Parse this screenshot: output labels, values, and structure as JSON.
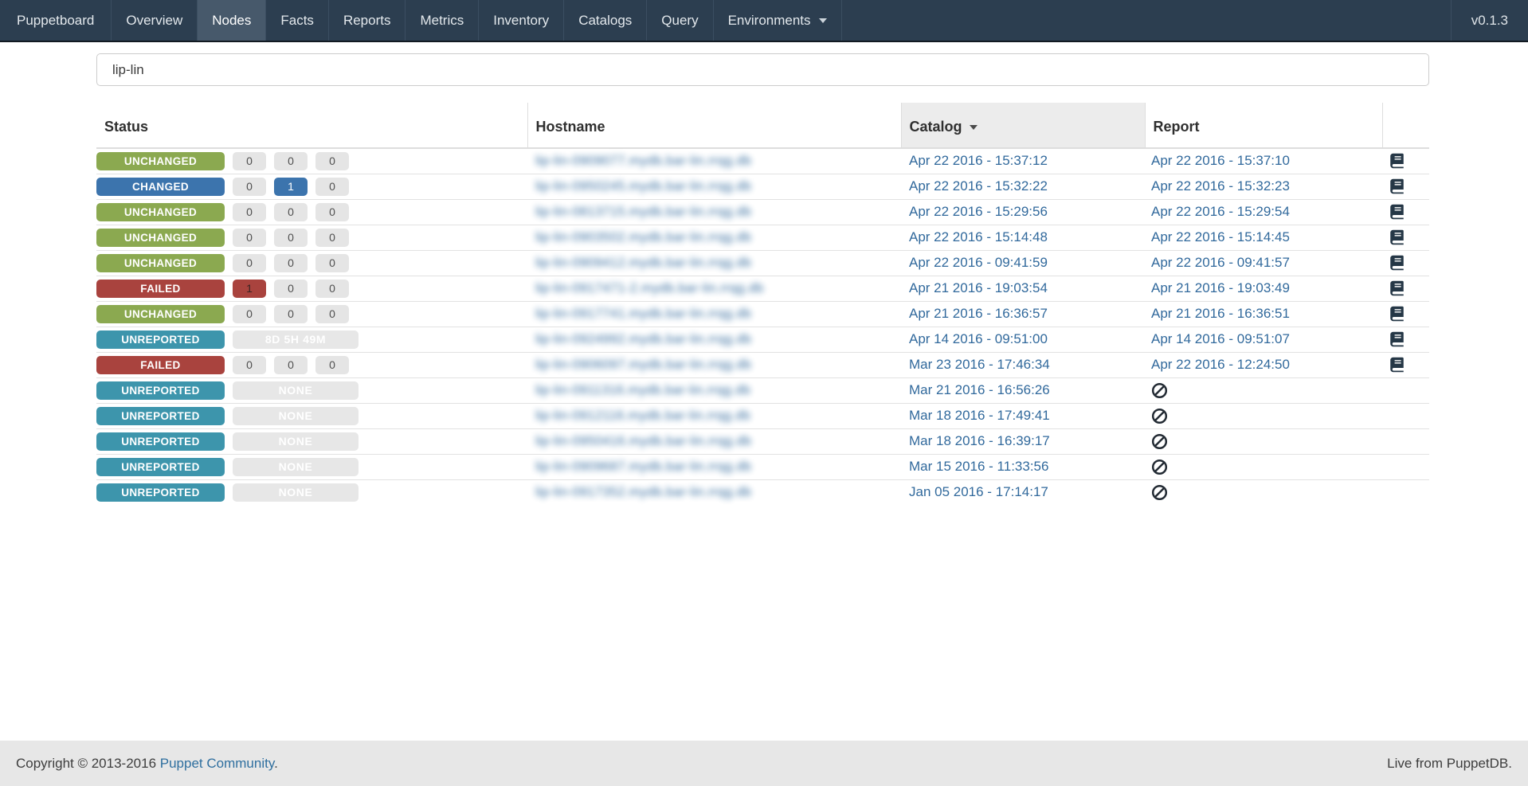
{
  "navbar": {
    "brand": "Puppetboard",
    "items": [
      "Overview",
      "Nodes",
      "Facts",
      "Reports",
      "Metrics",
      "Inventory",
      "Catalogs",
      "Query",
      "Environments"
    ],
    "active_item": "Nodes",
    "dropdown_items": [
      "Environments"
    ],
    "version": "v0.1.3"
  },
  "search": {
    "value": "lip-lin"
  },
  "table": {
    "columns": [
      "Status",
      "Hostname",
      "Catalog",
      "Report"
    ],
    "sorted_column": "Catalog",
    "sort_direction": "descending",
    "hostnames_blurred": true,
    "rows": [
      {
        "status": "UNCHANGED",
        "counts": [
          "0",
          "0",
          "0"
        ],
        "duration": null,
        "hostname_masked": "lip-lin-0909077.mydb.bar-lin.rrqg.db",
        "catalog": "Apr 22 2016 - 15:37:12",
        "report": "Apr 22 2016 - 15:37:10"
      },
      {
        "status": "CHANGED",
        "counts": [
          "0",
          "1",
          "0"
        ],
        "count_variants": [
          "default",
          "changed",
          "default"
        ],
        "duration": null,
        "hostname_masked": "lip-lin-0950245.mydb.bar-lin.rrqg.db",
        "catalog": "Apr 22 2016 - 15:32:22",
        "report": "Apr 22 2016 - 15:32:23"
      },
      {
        "status": "UNCHANGED",
        "counts": [
          "0",
          "0",
          "0"
        ],
        "duration": null,
        "hostname_masked": "lip-lin-0813715.mydb.bar-lin.rrqg.db",
        "catalog": "Apr 22 2016 - 15:29:56",
        "report": "Apr 22 2016 - 15:29:54"
      },
      {
        "status": "UNCHANGED",
        "counts": [
          "0",
          "0",
          "0"
        ],
        "duration": null,
        "hostname_masked": "lip-lin-0903502.mydb.bar-lin.rrqg.db",
        "catalog": "Apr 22 2016 - 15:14:48",
        "report": "Apr 22 2016 - 15:14:45"
      },
      {
        "status": "UNCHANGED",
        "counts": [
          "0",
          "0",
          "0"
        ],
        "duration": null,
        "hostname_masked": "lip-lin-0909412.mydb.bar-lin.rrqg.db",
        "catalog": "Apr 22 2016 - 09:41:59",
        "report": "Apr 22 2016 - 09:41:57"
      },
      {
        "status": "FAILED",
        "counts": [
          "1",
          "0",
          "0"
        ],
        "count_variants": [
          "failed",
          "default",
          "default"
        ],
        "duration": null,
        "hostname_masked": "lip-lin-0917471-2.mydb.bar-lin.rrqg.db",
        "catalog": "Apr 21 2016 - 19:03:54",
        "report": "Apr 21 2016 - 19:03:49"
      },
      {
        "status": "UNCHANGED",
        "counts": [
          "0",
          "0",
          "0"
        ],
        "duration": null,
        "hostname_masked": "lip-lin-0917741.mydb.bar-lin.rrqg.db",
        "catalog": "Apr 21 2016 - 16:36:57",
        "report": "Apr 21 2016 - 16:36:51"
      },
      {
        "status": "UNREPORTED",
        "counts": null,
        "duration": "8D 5H 49M",
        "hostname_masked": "lip-lin-0924992.mydb.bar-lin.rrqg.db",
        "catalog": "Apr 14 2016 - 09:51:00",
        "report": "Apr 14 2016 - 09:51:07"
      },
      {
        "status": "FAILED",
        "counts": [
          "0",
          "0",
          "0"
        ],
        "duration": null,
        "hostname_masked": "lip-lin-0906097.mydb.bar-lin.rrqg.db",
        "catalog": "Mar 23 2016 - 17:46:34",
        "report": "Apr 22 2016 - 12:24:50"
      },
      {
        "status": "UNREPORTED",
        "counts": null,
        "duration": "NONE",
        "hostname_masked": "lip-lin-0911316.mydb.bar-lin.rrqg.db",
        "catalog": "Mar 21 2016 - 16:56:26",
        "report": null
      },
      {
        "status": "UNREPORTED",
        "counts": null,
        "duration": "NONE",
        "hostname_masked": "lip-lin-0912116.mydb.bar-lin.rrqg.db",
        "catalog": "Mar 18 2016 - 17:49:41",
        "report": null
      },
      {
        "status": "UNREPORTED",
        "counts": null,
        "duration": "NONE",
        "hostname_masked": "lip-lin-0950416.mydb.bar-lin.rrqg.db",
        "catalog": "Mar 18 2016 - 16:39:17",
        "report": null
      },
      {
        "status": "UNREPORTED",
        "counts": null,
        "duration": "NONE",
        "hostname_masked": "lip-lin-0909687.mydb.bar-lin.rrqg.db",
        "catalog": "Mar 15 2016 - 11:33:56",
        "report": null
      },
      {
        "status": "UNREPORTED",
        "counts": null,
        "duration": "NONE",
        "hostname_masked": "lip-lin-0917352.mydb.bar-lin.rrqg.db",
        "catalog": "Jan 05 2016 - 17:14:17",
        "report": null
      }
    ]
  },
  "footer": {
    "copyright_prefix": "Copyright © 2013-2016",
    "community_link_label": "Puppet Community",
    "copyright_suffix": ".",
    "live_text": "Live from PuppetDB."
  },
  "colors": {
    "navbar_bg": "#2c3e50",
    "navbar_active_bg": "#47596b",
    "status_unchanged": "#8ba950",
    "status_changed": "#3c74ad",
    "status_failed": "#a9433e",
    "status_unreported": "#3d95ac",
    "count_box_bg": "#e5e5e5",
    "link_blue": "#31699c",
    "sorted_header_bg": "#ececec",
    "footer_bg": "#e7e7e7"
  }
}
